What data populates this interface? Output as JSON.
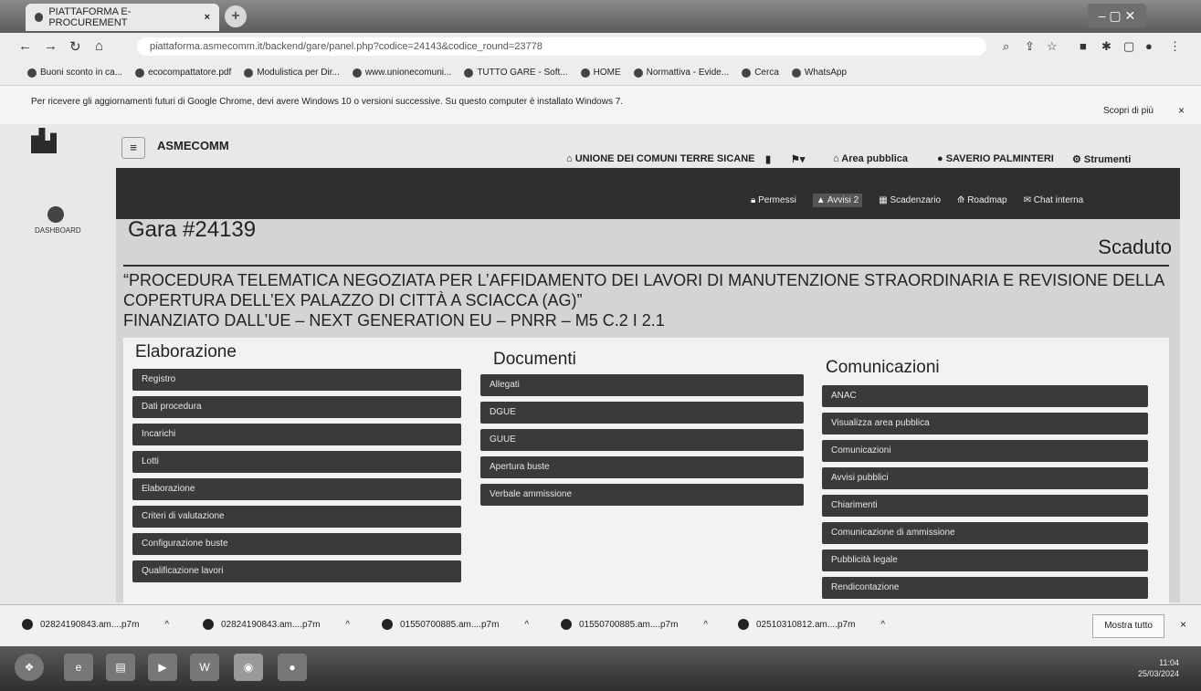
{
  "browser": {
    "tab_title": "PIATTAFORMA E-PROCUREMENT",
    "tab_close": "×",
    "new_tab": "+",
    "url": "piattaforma.asmecomm.it/backend/gare/panel.php?codice=24143&codice_round=23778",
    "bookmarks": [
      "Buoni sconto in ca...",
      "ecocompattatore.pdf",
      "Modulistica per Dir...",
      "www.unionecomuni...",
      "TUTTO GARE - Soft...",
      "HOME",
      "Normattiva - Evide...",
      "Cerca",
      "WhatsApp"
    ],
    "info_text": "Per ricevere gli aggiornamenti futuri di Google Chrome, devi avere Windows 10 o versioni successive. Su questo computer è installato Windows 7.",
    "info_more": "Scopri di più",
    "info_close": "×"
  },
  "app": {
    "brand": "ASMECOMM",
    "hamburger": "≡",
    "dashboard_label": "DASHBOARD",
    "topnav": {
      "union": "UNIONE DEI COMUNI TERRE SICANE",
      "area_pubblica": "Area pubblica",
      "user": "SAVERIO PALMINTERI",
      "strumenti": "Strumenti"
    },
    "subnav": {
      "permessi": "Permessi",
      "avvisi": "Avvisi",
      "avvisi_badge": "2",
      "scadenzario": "Scadenzario",
      "roadmap": "Roadmap",
      "chat": "Chat interna"
    }
  },
  "gara": {
    "title": "Gara #24139",
    "status": "Scaduto",
    "description_line1": "“PROCEDURA TELEMATICA NEGOZIATA PER L’AFFIDAMENTO DEI LAVORI DI MANUTENZIONE STRAORDINARIA E REVISIONE DELLA",
    "description_line2": "COPERTURA DELL’EX PALAZZO DI CITTÀ A SCIACCA (AG)”",
    "description_line3": "FINANZIATO DALL’UE – NEXT GENERATION EU – PNRR – M5 C.2 I 2.1"
  },
  "columns": {
    "elaborazione": {
      "title": "Elaborazione",
      "items": [
        "Registro",
        "Dati procedura",
        "Incarichi",
        "Lotti",
        "Elaborazione",
        "Criteri di valutazione",
        "Configurazione buste",
        "Qualificazione lavori"
      ]
    },
    "documenti": {
      "title": "Documenti",
      "items": [
        "Allegati",
        "DGUE",
        "GUUE",
        "Apertura buste",
        "Verbale ammissione"
      ]
    },
    "comunicazioni": {
      "title": "Comunicazioni",
      "items": [
        "ANAC",
        "Visualizza area pubblica",
        "Comunicazioni",
        "Avvisi pubblici",
        "Chiarimenti",
        "Comunicazione di ammissione",
        "Pubblicità legale",
        "Rendicontazione"
      ]
    }
  },
  "downloads": {
    "files": [
      "02824190843.am....p7m",
      "02824190843.am....p7m",
      "01550700885.am....p7m",
      "01550700885.am....p7m",
      "02510310812.am....p7m"
    ],
    "caret": "^",
    "show_all": "Mostra tutto",
    "close": "×"
  },
  "taskbar": {
    "time": "11:04",
    "date": "25/03/2024"
  }
}
